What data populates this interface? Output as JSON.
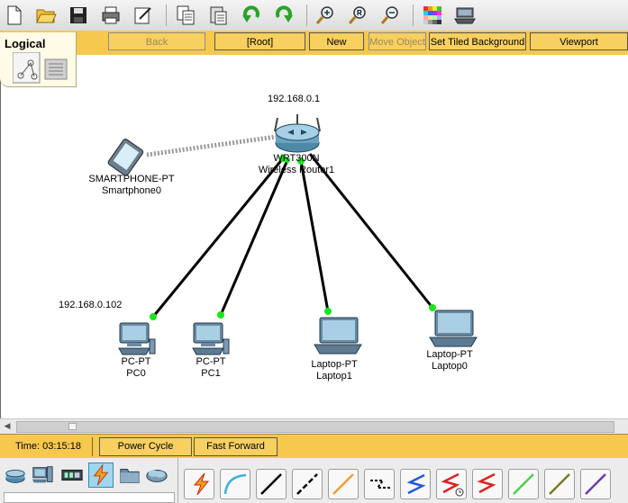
{
  "toolbar": {
    "icons": [
      "new-file-icon",
      "open-folder-icon",
      "save-icon",
      "print-icon",
      "activity-wizard-icon",
      "copy-icon",
      "paste-icon",
      "undo-icon",
      "redo-icon",
      "zoom-in-icon",
      "zoom-reset-icon",
      "zoom-out-icon",
      "palette-icon",
      "custom-device-icon"
    ]
  },
  "nav": {
    "logical": "Logical",
    "back": "Back",
    "root": "[Root]",
    "new_cluster": "New Cluster",
    "move_object": "Move Object",
    "set_tiled_background": "Set Tiled Background",
    "viewport": "Viewport"
  },
  "workspace": {
    "router": {
      "ip": "192.168.0.1",
      "model": "WRT300N",
      "name": "Wireless Router1"
    },
    "smartphone": {
      "model": "SMARTPHONE-PT",
      "name": "Smartphone0"
    },
    "pc0": {
      "ip": "192.168.0.102",
      "model": "PC-PT",
      "name": "PC0"
    },
    "pc1": {
      "model": "PC-PT",
      "name": "PC1"
    },
    "laptop1": {
      "model": "Laptop-PT",
      "name": "Laptop1"
    },
    "laptop0": {
      "model": "Laptop-PT",
      "name": "Laptop0"
    },
    "link_color": "#000000",
    "link_up_color": "#19e619"
  },
  "status": {
    "time_label": "Time: 03:15:18",
    "power_cycle": "Power Cycle Devices",
    "fast_forward": "Fast Forward Time"
  },
  "device_categories": [
    "network-devices-icon",
    "end-devices-icon",
    "components-icon",
    "connections-icon",
    "miscellaneous-icon",
    "multiuser-icon"
  ],
  "selected_category": "connections-icon",
  "cables": [
    {
      "icon": "automatic-connection-icon",
      "color": "#e8a020"
    },
    {
      "icon": "console-cable-icon",
      "color": "#3ab0e0"
    },
    {
      "icon": "copper-straight-through-icon",
      "color": "#000000"
    },
    {
      "icon": "copper-cross-over-icon",
      "color": "#000000"
    },
    {
      "icon": "fiber-icon",
      "color": "#f0a030"
    },
    {
      "icon": "phone-cable-icon",
      "color": "#000000"
    },
    {
      "icon": "coaxial-icon",
      "color": "#1f5bd8"
    },
    {
      "icon": "serial-dce-icon",
      "color": "#e02020"
    },
    {
      "icon": "serial-dte-icon",
      "color": "#e02020"
    },
    {
      "icon": "octal-cable-icon",
      "color": "#4cd04c"
    },
    {
      "icon": "iot-custom-cable-icon",
      "color": "#7a7a20"
    },
    {
      "icon": "usb-cable-icon",
      "color": "#6a3ab0"
    }
  ]
}
